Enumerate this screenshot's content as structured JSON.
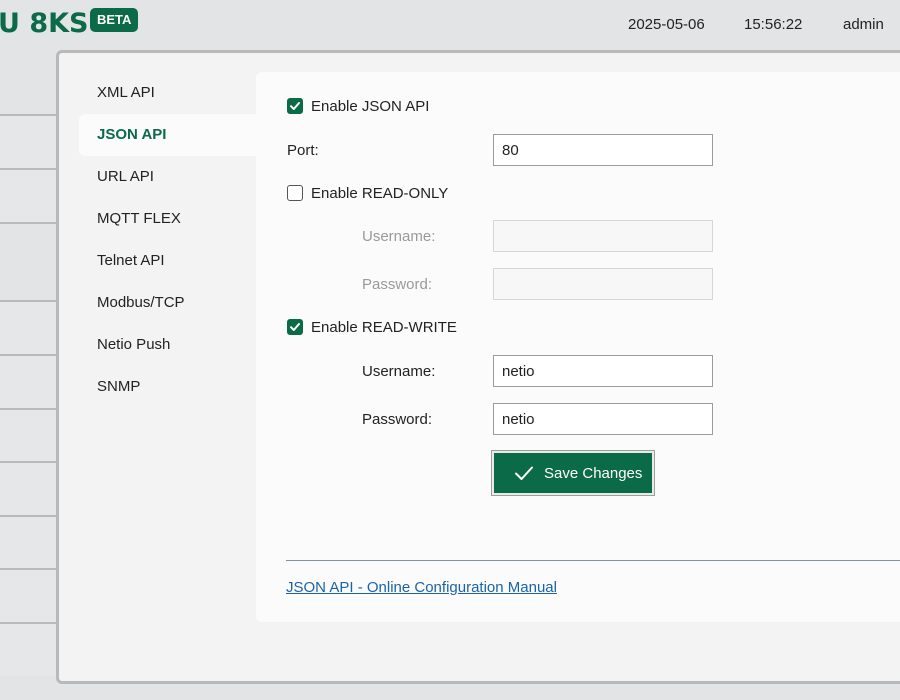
{
  "header": {
    "logo_text": "U 8KS",
    "badge": "BETA",
    "date": "2025-05-06",
    "time": "15:56:22",
    "user": "admin"
  },
  "subnav": {
    "items": [
      {
        "label": "XML API",
        "active": false
      },
      {
        "label": "JSON API",
        "active": true
      },
      {
        "label": "URL API",
        "active": false
      },
      {
        "label": "MQTT FLEX",
        "active": false
      },
      {
        "label": "Telnet API",
        "active": false
      },
      {
        "label": "Modbus/TCP",
        "active": false
      },
      {
        "label": "Netio Push",
        "active": false
      },
      {
        "label": "SNMP",
        "active": false
      }
    ]
  },
  "form": {
    "enable_json_label": "Enable JSON API",
    "enable_json_checked": true,
    "port_label": "Port:",
    "port_value": "80",
    "read_only_label": "Enable READ-ONLY",
    "read_only_checked": false,
    "ro_username_label": "Username:",
    "ro_username_value": "",
    "ro_password_label": "Password:",
    "ro_password_value": "",
    "read_write_label": "Enable READ-WRITE",
    "read_write_checked": true,
    "rw_username_label": "Username:",
    "rw_username_value": "netio",
    "rw_password_label": "Password:",
    "rw_password_value": "netio",
    "save_label": "Save Changes"
  },
  "footer": {
    "manual_link": "JSON API - Online Configuration Manual"
  },
  "colors": {
    "accent": "#0b6a47",
    "link": "#1a64a6"
  }
}
